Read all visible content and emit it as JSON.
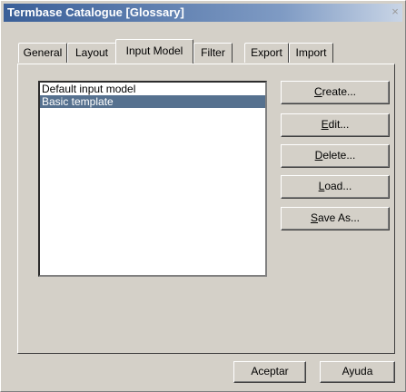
{
  "window": {
    "title": "Termbase Catalogue [Glossary]",
    "close_glyph": "×"
  },
  "tabs": [
    {
      "label": "General"
    },
    {
      "label": "Layout"
    },
    {
      "label": "Input Model",
      "active": true
    },
    {
      "label": "Filter"
    },
    {
      "label": "Export"
    },
    {
      "label": "Import"
    }
  ],
  "input_models": {
    "items": [
      {
        "label": "Default input model",
        "selected": false
      },
      {
        "label": "Basic template",
        "selected": true
      }
    ]
  },
  "side_buttons": {
    "create": {
      "mnemonic": "C",
      "rest": "reate..."
    },
    "edit": {
      "mnemonic": "E",
      "rest": "dit..."
    },
    "delete": {
      "mnemonic": "D",
      "rest": "elete..."
    },
    "load": {
      "mnemonic": "L",
      "rest": "oad..."
    },
    "save_as": {
      "mnemonic": "S",
      "rest": "ave As..."
    }
  },
  "footer": {
    "ok_label": "Aceptar",
    "help_label": "Ayuda"
  },
  "colors": {
    "title_start": "#3a5f98",
    "selection": "#56718f",
    "face": "#d4d0c8"
  }
}
